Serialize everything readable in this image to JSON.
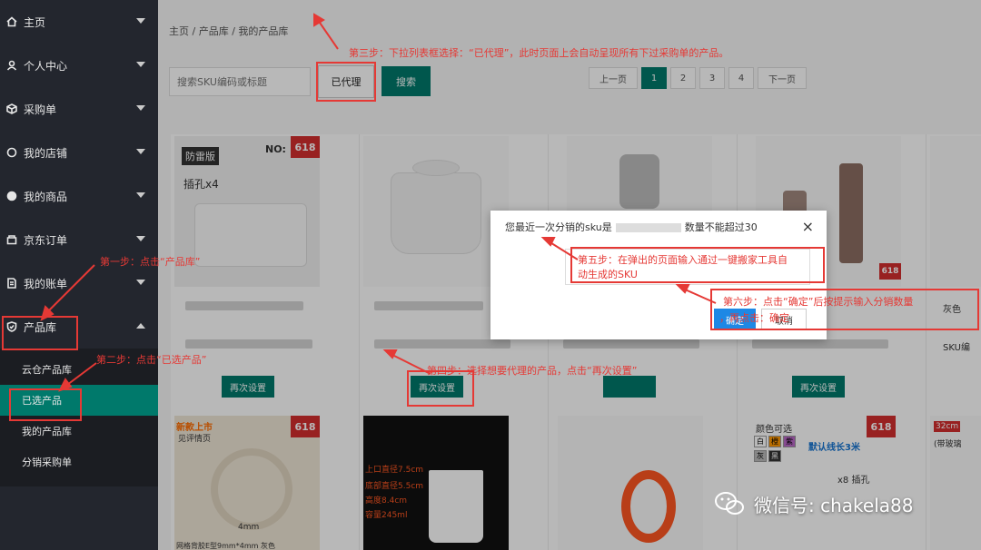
{
  "sidebar": {
    "items": [
      {
        "label": "主页",
        "icon": "home-icon"
      },
      {
        "label": "个人中心",
        "icon": "user-icon"
      },
      {
        "label": "采购单",
        "icon": "box-icon"
      },
      {
        "label": "我的店铺",
        "icon": "store-icon"
      },
      {
        "label": "我的商品",
        "icon": "goods-icon"
      },
      {
        "label": "京东订单",
        "icon": "order-icon"
      },
      {
        "label": "我的账单",
        "icon": "bill-icon"
      },
      {
        "label": "产品库",
        "icon": "shield-icon"
      }
    ],
    "submenu": [
      "云仓产品库",
      "已选产品",
      "我的产品库",
      "分销采购单"
    ]
  },
  "breadcrumb": "主页 / 产品库 / 我的产品库",
  "search": {
    "placeholder": "搜索SKU编码或标题",
    "select_value": "已代理",
    "button": "搜索"
  },
  "pager": {
    "prev": "上一页",
    "pages": [
      "1",
      "2",
      "3",
      "4"
    ],
    "next": "下一页",
    "current": "1"
  },
  "products": {
    "reset_label": "再次设置",
    "badge": "618",
    "card1_tag": "防雷版",
    "card1_text": "插孔x4",
    "card1_no": "NO:",
    "new_tag": "新款上市",
    "card5_text": "见评情页",
    "card5_dim": "4mm",
    "card5_caption": "网格背胶E型9mm*4mm 灰色",
    "cup_text": [
      "上口直径7.5cm",
      "底部直径5.5cm",
      "高度8.4cm",
      "容量245ml"
    ],
    "color_text": "颜色可选",
    "colors": [
      "白",
      "橙",
      "紫",
      "灰",
      "黑"
    ],
    "line_text": "默认线长3米",
    "socket_text": "x8 插孔",
    "pot_size": "32cm",
    "pot_text": "(带玻璃",
    "side_color": "灰色",
    "side_sku": "SKU编"
  },
  "modal": {
    "title": "您最近一次分销的sku是",
    "title_tail": "数量不能超过30",
    "close": "×",
    "ok": "确定",
    "cancel": "取消"
  },
  "annotations": {
    "step1": "第一步：点击“产品库”",
    "step2": "第二步：点击“已选产品”",
    "step3": "第三步：下拉列表框选择：“已代理”，此时页面上会自动呈现所有下过采购单的产品。",
    "step4": "第四步：选择想要代理的产品，点击“再次设置”",
    "step5a": "第五步：在弹出的页面输入通过一键搬家工具自",
    "step5b": "动生成的SKU",
    "step6a": "第六步：点击“确定”后按提示输入分销数量",
    "step6b": "，再点击：确定"
  },
  "watermark": "微信号: chakela88",
  "colors": {
    "sidebar": "#23262e",
    "accent": "#00796b",
    "annotation": "#e53935",
    "ok_button": "#1e88e5"
  }
}
